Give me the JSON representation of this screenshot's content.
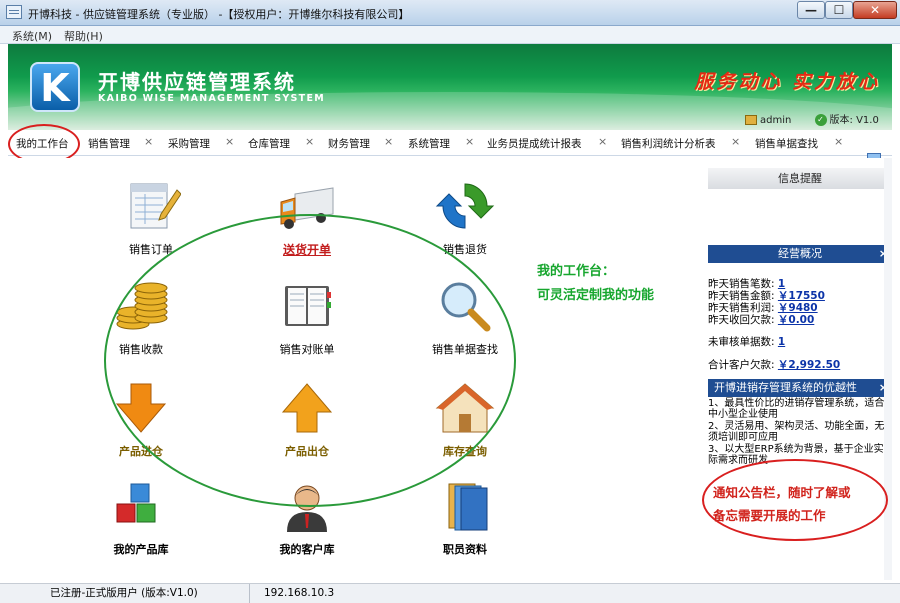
{
  "window": {
    "title": "开博科技 - 供应链管理系统（专业版） -【授权用户：开博维尔科技有限公司】",
    "min_glyph": "—",
    "max_glyph": "☐",
    "close_glyph": "✕"
  },
  "menu": [
    "系统(M)",
    "帮助(H)"
  ],
  "banner": {
    "logo_letter": "K",
    "brand_cn": "开博供应链管理系统",
    "brand_en": "KAIBO WISE MANAGEMENT SYSTEM",
    "slogan": "服务动心 实力放心",
    "user": "admin",
    "version_label": "版本: V1.0"
  },
  "tabs": [
    "我的工作台",
    "销售管理",
    "采购管理",
    "仓库管理",
    "财务管理",
    "系统管理",
    "业务员提成统计报表",
    "销售利润统计分析表",
    "销售单据查找"
  ],
  "tab_close_glyph": "×",
  "functions": [
    {
      "label": "销售订单",
      "icon": "order-form-icon"
    },
    {
      "label": "送货开单",
      "icon": "delivery-truck-icon"
    },
    {
      "label": "销售退货",
      "icon": "return-arrows-icon"
    },
    {
      "label": "销售收款",
      "icon": "coins-icon"
    },
    {
      "label": "销售对账单",
      "icon": "ledger-book-icon"
    },
    {
      "label": "销售单据查找",
      "icon": "magnifier-icon"
    },
    {
      "label": "产品进仓",
      "icon": "arrow-down-icon"
    },
    {
      "label": "产品出仓",
      "icon": "arrow-up-icon"
    },
    {
      "label": "库存查询",
      "icon": "house-icon"
    },
    {
      "label": "我的产品库",
      "icon": "cubes-icon"
    },
    {
      "label": "我的客户库",
      "icon": "customer-person-icon"
    },
    {
      "label": "职员资料",
      "icon": "staff-folders-icon"
    }
  ],
  "annotation_center": [
    "我的工作台：",
    "可灵活定制我的功能"
  ],
  "sidebar": {
    "reminder_title": "信息提醒",
    "overview_title": "经营概况",
    "close_glyph": "×",
    "stats": [
      {
        "label": "昨天销售笔数:",
        "value": "1"
      },
      {
        "label": "昨天销售金额:",
        "value": "￥17550"
      },
      {
        "label": "昨天销售利润:",
        "value": "￥9480"
      },
      {
        "label": "昨天收回欠款:",
        "value": "￥0.00"
      }
    ],
    "unchecked_label": "未审核单据数:",
    "unchecked_value": "1",
    "arrears_label": "合计客户欠款:",
    "arrears_value": "￥2,992.50",
    "advantages_title": "开博进销存管理系统的优越性",
    "advantages": [
      "1、最具性价比的进销存管理系统，适合中小型企业使用",
      "2、灵活易用、架构灵活、功能全面，无须培训即可应用",
      "3、以大型ERP系统为背景，基于企业实际需求而研发"
    ],
    "note": [
      "通知公告栏，随时了解或",
      "备忘需要开展的工作"
    ]
  },
  "status": {
    "reg": "已注册-正式版用户 (版本:V1.0)",
    "ip": "192.168.10.3"
  },
  "colors": {
    "banner_green": "#109b4c",
    "side_header_blue": "#1f4d92",
    "link_blue": "#0b33a8",
    "annotation_red": "#d91f1f",
    "annotation_green": "#17a62e"
  }
}
